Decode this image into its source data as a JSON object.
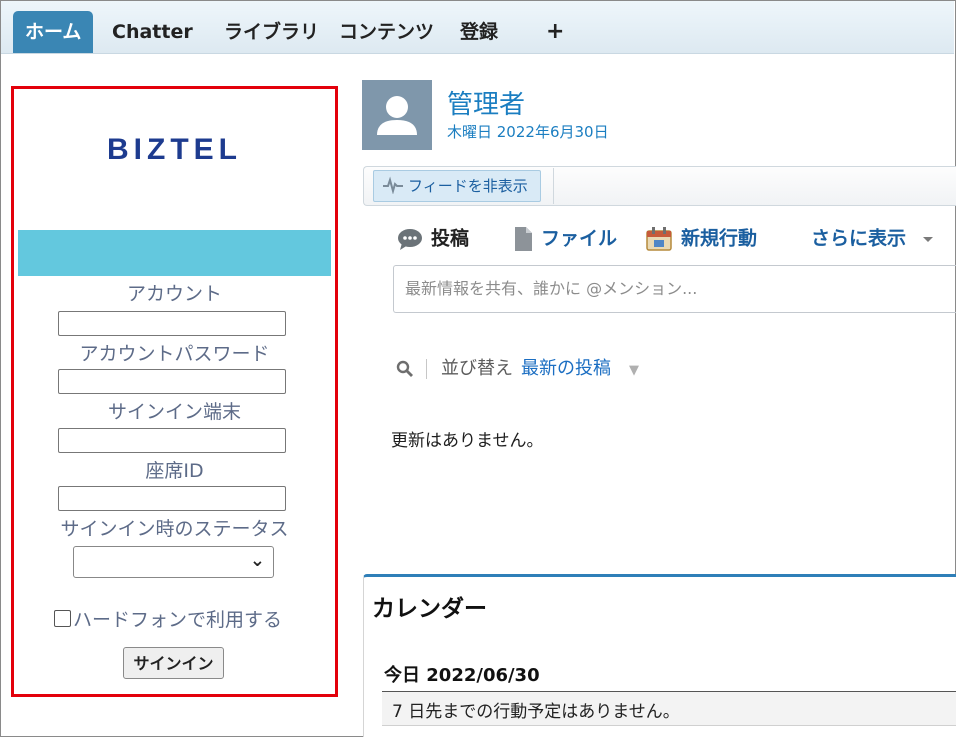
{
  "tabs": [
    {
      "label": "ホーム",
      "active": true
    },
    {
      "label": "Chatter"
    },
    {
      "label": "ライブラリ"
    },
    {
      "label": "コンテンツ"
    },
    {
      "label": "登録"
    },
    {
      "label": "+"
    }
  ],
  "biztel": {
    "logo": "BIZTEL",
    "account_label": "アカウント",
    "account_value": "",
    "password_label": "アカウントパスワード",
    "password_value": "",
    "terminal_label": "サインイン端末",
    "terminal_value": "",
    "seat_label": "座席ID",
    "seat_value": "",
    "status_label": "サインイン時のステータス",
    "status_value": "",
    "hardphone_label": "ハードフォンで利用する",
    "hardphone_checked": false,
    "signin_button": "サインイン",
    "border_color": "#e3000b",
    "band_color": "#63c8de"
  },
  "profile": {
    "name": "管理者",
    "date": "木曜日 2022年6月30日",
    "avatar_icon": "user-silhouette-icon"
  },
  "feed": {
    "toggle_label": "フィードを非表示",
    "publisher": [
      {
        "label": "投稿",
        "icon": "speech-bubble-icon",
        "color": "#222222"
      },
      {
        "label": "ファイル",
        "icon": "file-icon",
        "color": "#1b5fa0"
      },
      {
        "label": "新規行動",
        "icon": "calendar-icon",
        "color": "#1b5fa0"
      },
      {
        "label": "さらに表示",
        "icon": "caret-down-icon",
        "color": "#1b5fa0"
      }
    ],
    "composer_placeholder": "最新情報を共有、誰かに @メンション...",
    "sort_label": "並び替え",
    "sort_value": "最新の投稿",
    "empty_message": "更新はありません。"
  },
  "calendar": {
    "title": "カレンダー",
    "today_label": "今日 2022/06/30",
    "empty_message": "7 日先までの行動予定はありません。"
  }
}
